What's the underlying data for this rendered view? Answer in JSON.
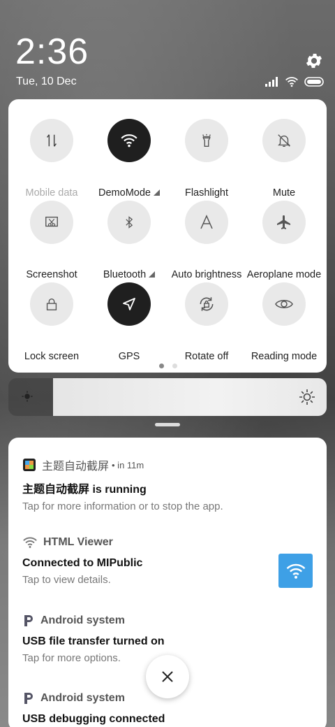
{
  "status": {
    "time": "2:36",
    "date": "Tue, 10 Dec"
  },
  "icons": {
    "settings": "gear-icon",
    "signal": "signal-icon",
    "wifi": "wifi-icon",
    "battery": "battery-icon"
  },
  "quick_settings": {
    "tiles": [
      {
        "label": "Mobile data",
        "icon": "mobile-data-icon",
        "active": false
      },
      {
        "label": "DemoMode",
        "icon": "wifi-icon",
        "active": true
      },
      {
        "label": "Flashlight",
        "icon": "flashlight-icon",
        "active": false
      },
      {
        "label": "Mute",
        "icon": "bell-off-icon",
        "active": false
      },
      {
        "label": "Screenshot",
        "icon": "screenshot-icon",
        "active": false
      },
      {
        "label": "Bluetooth",
        "icon": "bluetooth-icon",
        "active": false
      },
      {
        "label": "Auto brightness",
        "icon": "auto-brightness-icon",
        "active": false
      },
      {
        "label": "Aeroplane mode",
        "icon": "airplane-icon",
        "active": false
      },
      {
        "label": "Lock screen",
        "icon": "lock-icon",
        "active": false
      },
      {
        "label": "GPS",
        "icon": "location-icon",
        "active": true
      },
      {
        "label": "Rotate off",
        "icon": "rotate-lock-icon",
        "active": false
      },
      {
        "label": "Reading mode",
        "icon": "eye-icon",
        "active": false
      }
    ],
    "page_count": 2,
    "current_page": 1
  },
  "brightness": {
    "level": 0.86
  },
  "notifications": [
    {
      "app": "主题自动截屏",
      "time": "• in 11m",
      "title": "主题自动截屏 is running",
      "text": "Tap for more information or to stop the app."
    },
    {
      "app": "HTML Viewer",
      "title": "Connected to MIPublic",
      "text": "Tap to view details."
    },
    {
      "app": "Android system",
      "title": "USB file transfer turned on",
      "text": "Tap for more options."
    },
    {
      "app": "Android system",
      "title": "USB debugging connected"
    }
  ],
  "colors": {
    "active_tile": "#1f1f1f",
    "inactive_tile": "#e9e9e9",
    "wifi_accent": "#3ea0e6"
  }
}
